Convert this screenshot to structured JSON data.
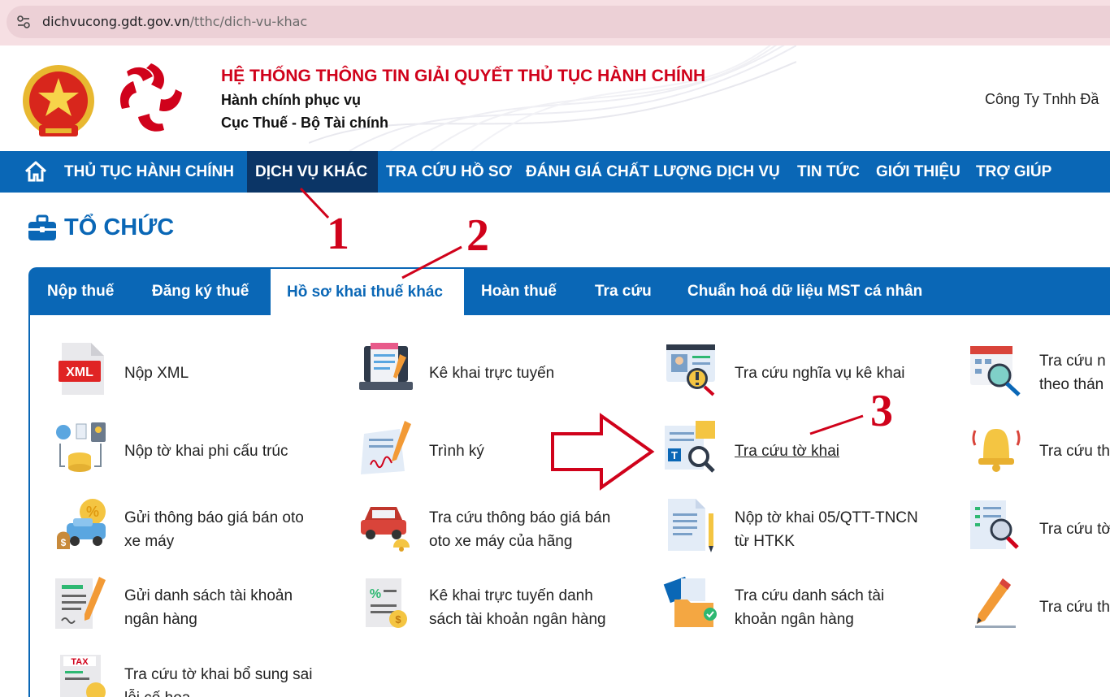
{
  "browser": {
    "url_host": "dichvucong.gdt.gov.vn",
    "url_path": "/tthc/dich-vu-khac"
  },
  "header": {
    "system_title": "HỆ THỐNG THÔNG TIN GIẢI QUYẾT THỦ TỤC HÀNH CHÍNH",
    "subtitle_1": "Hành chính phục vụ",
    "subtitle_2": "Cục Thuế - Bộ Tài chính",
    "company": "Công Ty Tnhh Đầ"
  },
  "nav": {
    "items": [
      {
        "label": "THỦ TỤC HÀNH CHÍNH"
      },
      {
        "label": "DỊCH VỤ KHÁC",
        "active": true
      },
      {
        "label": "TRA CỨU HỒ SƠ"
      },
      {
        "label": "ĐÁNH GIÁ CHẤT LƯỢNG DỊCH VỤ"
      },
      {
        "label": "TIN TỨC"
      },
      {
        "label": "GIỚI THIỆU"
      },
      {
        "label": "TRỢ GIÚP"
      }
    ]
  },
  "section": {
    "title": "TỔ CHỨC"
  },
  "tabs": [
    {
      "label": "Nộp thuế"
    },
    {
      "label": "Đăng ký thuế"
    },
    {
      "label": "Hồ sơ khai thuế khác",
      "active": true
    },
    {
      "label": "Hoàn thuế"
    },
    {
      "label": "Tra cứu"
    },
    {
      "label": "Chuẩn hoá dữ liệu MST cá nhân"
    }
  ],
  "services": {
    "col1": [
      {
        "line1": "Nộp XML",
        "line2": "",
        "icon": "xml-file-icon"
      },
      {
        "line1": "Nộp tờ khai phi cấu trúc",
        "line2": "",
        "icon": "data-flow-icon"
      },
      {
        "line1": "Gửi thông báo giá bán oto",
        "line2": "xe máy",
        "icon": "car-price-icon"
      },
      {
        "line1": "Gửi danh sách tài khoản",
        "line2": "ngân hàng",
        "icon": "document-pen-icon"
      },
      {
        "line1": "Tra cứu tờ khai bổ sung sai",
        "line2": "lỗi cố hoa",
        "icon": "tax-document-icon"
      }
    ],
    "col2": [
      {
        "line1": "Kê khai trực tuyến",
        "line2": "",
        "icon": "laptop-form-icon"
      },
      {
        "line1": "Trình ký",
        "line2": "",
        "icon": "signature-icon"
      },
      {
        "line1": "Tra cứu thông báo giá bán",
        "line2": "oto xe máy của hãng",
        "icon": "car-bell-icon"
      },
      {
        "line1": "Kê khai trực tuyến danh",
        "line2": "sách tài khoản ngân hàng",
        "icon": "percent-document-icon"
      }
    ],
    "col3": [
      {
        "line1": "Tra cứu nghĩa vụ kê khai",
        "line2": "",
        "icon": "profile-warning-icon"
      },
      {
        "line1": "Tra cứu tờ khai",
        "line2": "",
        "icon": "search-document-icon",
        "link": true
      },
      {
        "line1": "Nộp tờ khai 05/QTT-TNCN",
        "line2": "từ HTKK",
        "icon": "document-pencil-icon"
      },
      {
        "line1": "Tra cứu danh sách tài",
        "line2": "khoản ngân hàng",
        "icon": "folder-check-icon"
      }
    ],
    "col4": [
      {
        "line1": "Tra cứu n",
        "line2": "theo thán",
        "icon": "calendar-search-icon"
      },
      {
        "line1": "Tra cứu th",
        "line2": "",
        "icon": "bell-icon"
      },
      {
        "line1": "Tra cứu tờ",
        "line2": "",
        "icon": "document-search-icon"
      },
      {
        "line1": "Tra cứu th",
        "line2": "",
        "icon": "pencil-icon"
      }
    ]
  },
  "annotations": [
    "1",
    "2",
    "3"
  ],
  "colors": {
    "primary": "#0a67b6",
    "nav_active": "#0b3566",
    "title_red": "#d0021b",
    "annotation_red": "#d0021b"
  }
}
